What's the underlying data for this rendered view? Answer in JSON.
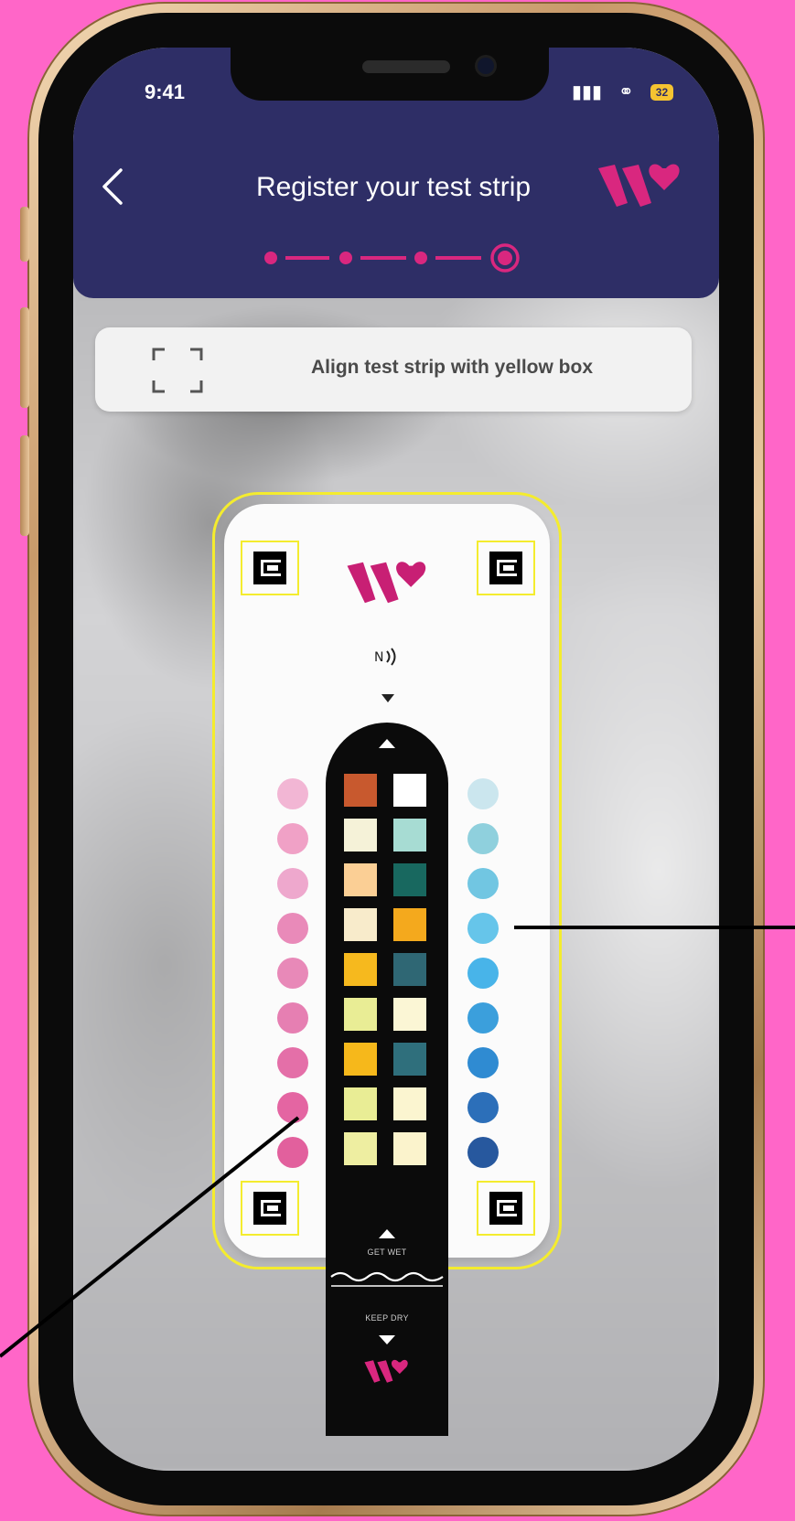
{
  "status_bar": {
    "time": "9:41",
    "battery": "32"
  },
  "header": {
    "title": "Register your test strip",
    "stepper_steps": 4,
    "current_step": 4
  },
  "prompt": {
    "text": "Align test strip with yellow box"
  },
  "strip_labels": {
    "get_wet": "GET WET",
    "keep_dry": "KEEP DRY"
  },
  "colors": {
    "background": "#ff66c8",
    "header": "#2e2e66",
    "brand_pink": "#d9277f",
    "highlight_yellow": "#f4ec2e",
    "left_reference_dots": [
      "#f2b6d4",
      "#f0a1c6",
      "#eea8cd",
      "#e98ab9",
      "#e889b8",
      "#e67fb2",
      "#e46fa8",
      "#e465a2",
      "#e2609d"
    ],
    "right_reference_dots": [
      "#cbe6ee",
      "#8fd0dd",
      "#71c6e2",
      "#66c5ea",
      "#48b4e9",
      "#3b9fdc",
      "#2f8bd2",
      "#2c6fb9",
      "#27589e"
    ],
    "pads_left": [
      "#c8592e",
      "#f5f2d8",
      "#fbcf95",
      "#f8ebcb",
      "#f6b91e",
      "#e9ed95",
      "#f6b81b",
      "#e9ed95",
      "#eeeea1"
    ],
    "pads_right": [
      "#ffffff",
      "#a7dcd3",
      "#18685f",
      "#f4a91d",
      "#2f6774",
      "#fbf6d5",
      "#2f6f7c",
      "#fbf5d0",
      "#fbf3cc"
    ]
  }
}
